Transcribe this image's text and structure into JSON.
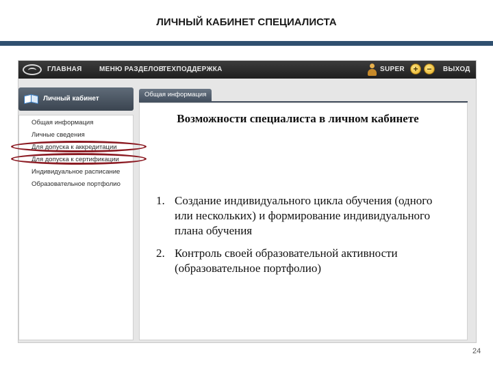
{
  "slide": {
    "title": "ЛИЧНЫЙ КАБИНЕТ СПЕЦИАЛИСТА",
    "page_number": "24"
  },
  "topnav": {
    "items": [
      "ГЛАВНАЯ",
      "МЕНЮ РАЗДЕЛОВ",
      "ТЕХПОДДЕРЖКА"
    ],
    "user": "SUPER",
    "logout": "ВЫХОД",
    "icons": [
      "logo-icon",
      "user-icon",
      "zoom-in-icon",
      "zoom-out-icon"
    ]
  },
  "sidebar": {
    "title": "Личный кабинет",
    "items": [
      "Общая информация",
      "Личные сведения",
      "Для допуска к аккредитации",
      "Для допуска к сертификации",
      "Индивидуальное расписание",
      "Образовательное портфолио"
    ]
  },
  "content": {
    "tab_label": "Общая информация"
  },
  "overlay": {
    "heading": "Возможности специалиста в личном кабинете",
    "list": [
      {
        "num": "1.",
        "text": "Создание индивидуального цикла обучения (одного или нескольких) и формирование индивидуального плана обучения"
      },
      {
        "num": "2.",
        "text": "Контроль своей образовательной активности (образовательное портфолио)"
      }
    ]
  },
  "colors": {
    "title_bar": "#2f4f6f",
    "nav_bar": "#2a2a2a",
    "highlight": "#8b1a22"
  }
}
